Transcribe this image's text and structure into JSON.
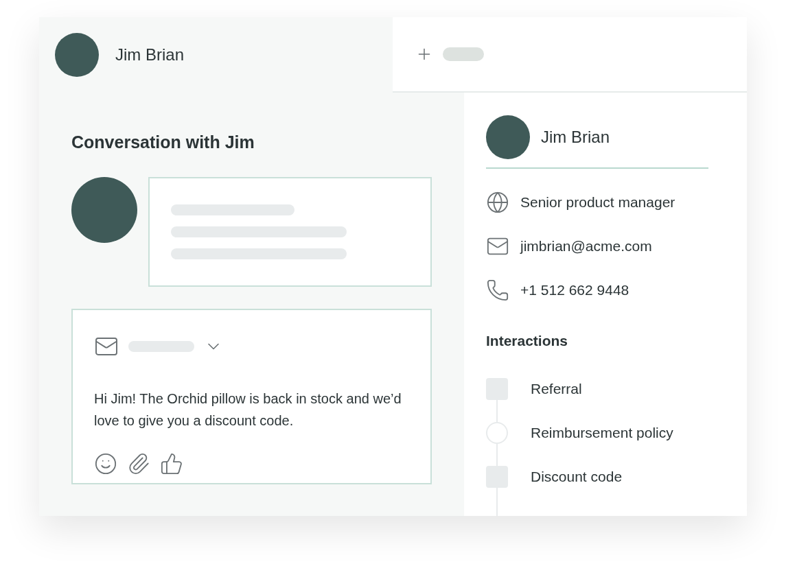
{
  "header": {
    "contact_name": "Jim Brian"
  },
  "conversation": {
    "title": "Conversation with Jim",
    "reply": {
      "message": "Hi Jim! The Orchid pillow is back in stock and we’d love to give you a discount code."
    }
  },
  "contact": {
    "name": "Jim Brian",
    "details": [
      {
        "kind": "role",
        "text": "Senior product manager"
      },
      {
        "kind": "email",
        "text": "jimbrian@acme.com"
      },
      {
        "kind": "phone",
        "text": "+1 512 662 9448"
      }
    ],
    "interactions_title": "Interactions",
    "interactions": [
      {
        "kind": "square",
        "label": "Referral"
      },
      {
        "kind": "circle",
        "label": "Reimbursement policy"
      },
      {
        "kind": "square",
        "label": "Discount code"
      }
    ]
  }
}
